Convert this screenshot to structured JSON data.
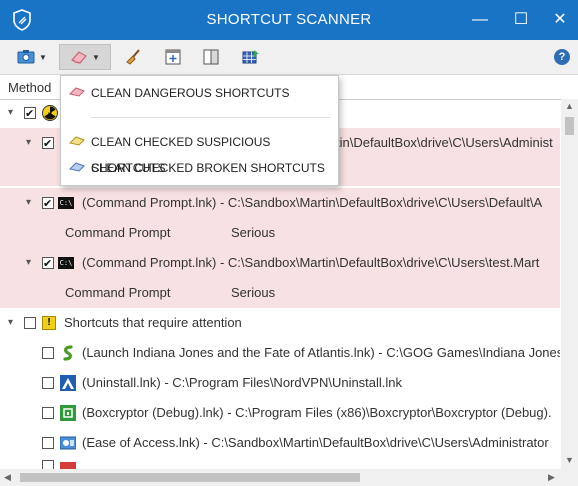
{
  "window": {
    "title": "SHORTCUT SCANNER",
    "minimize": "—",
    "maximize": "☐",
    "close": "✕"
  },
  "toolbar": {
    "help": "?"
  },
  "columns": {
    "method": "Method"
  },
  "menu": {
    "items": [
      {
        "label": "CLEAN DANGEROUS SHORTCUTS"
      },
      {
        "label": "CLEAN CHECKED SUSPICIOUS SHORTCUTS"
      },
      {
        "label": "CLEAN CHECKED BROKEN SHORTCUTS"
      }
    ]
  },
  "tree": {
    "dangerous_group": {
      "items": [
        {
          "text": "(Command Prompt.lnk) - C:\\Sandbox\\Martin\\DefaultBox\\drive\\C\\Users\\Administ"
        },
        {
          "text": "(Command Prompt.lnk) - C:\\Sandbox\\Martin\\DefaultBox\\drive\\C\\Users\\Default\\A",
          "name": "Command Prompt",
          "severity": "Serious"
        },
        {
          "text": "(Command Prompt.lnk) - C:\\Sandbox\\Martin\\DefaultBox\\drive\\C\\Users\\test.Mart",
          "name": "Command Prompt",
          "severity": "Serious"
        }
      ],
      "first_item_partial_text": "tin\\DefaultBox\\drive\\C\\Users\\Administ"
    },
    "attention_group": {
      "label": "Shortcuts that require attention",
      "items": [
        {
          "text": "(Launch Indiana Jones and the Fate of Atlantis.lnk) - C:\\GOG Games\\Indiana Jones"
        },
        {
          "text": "(Uninstall.lnk) - C:\\Program Files\\NordVPN\\Uninstall.lnk"
        },
        {
          "text": "(Boxcryptor (Debug).lnk) - C:\\Program Files (x86)\\Boxcryptor\\Boxcryptor (Debug)."
        },
        {
          "text": "(Ease of Access.lnk) - C:\\Sandbox\\Martin\\DefaultBox\\drive\\C\\Users\\Administrator"
        }
      ]
    }
  }
}
